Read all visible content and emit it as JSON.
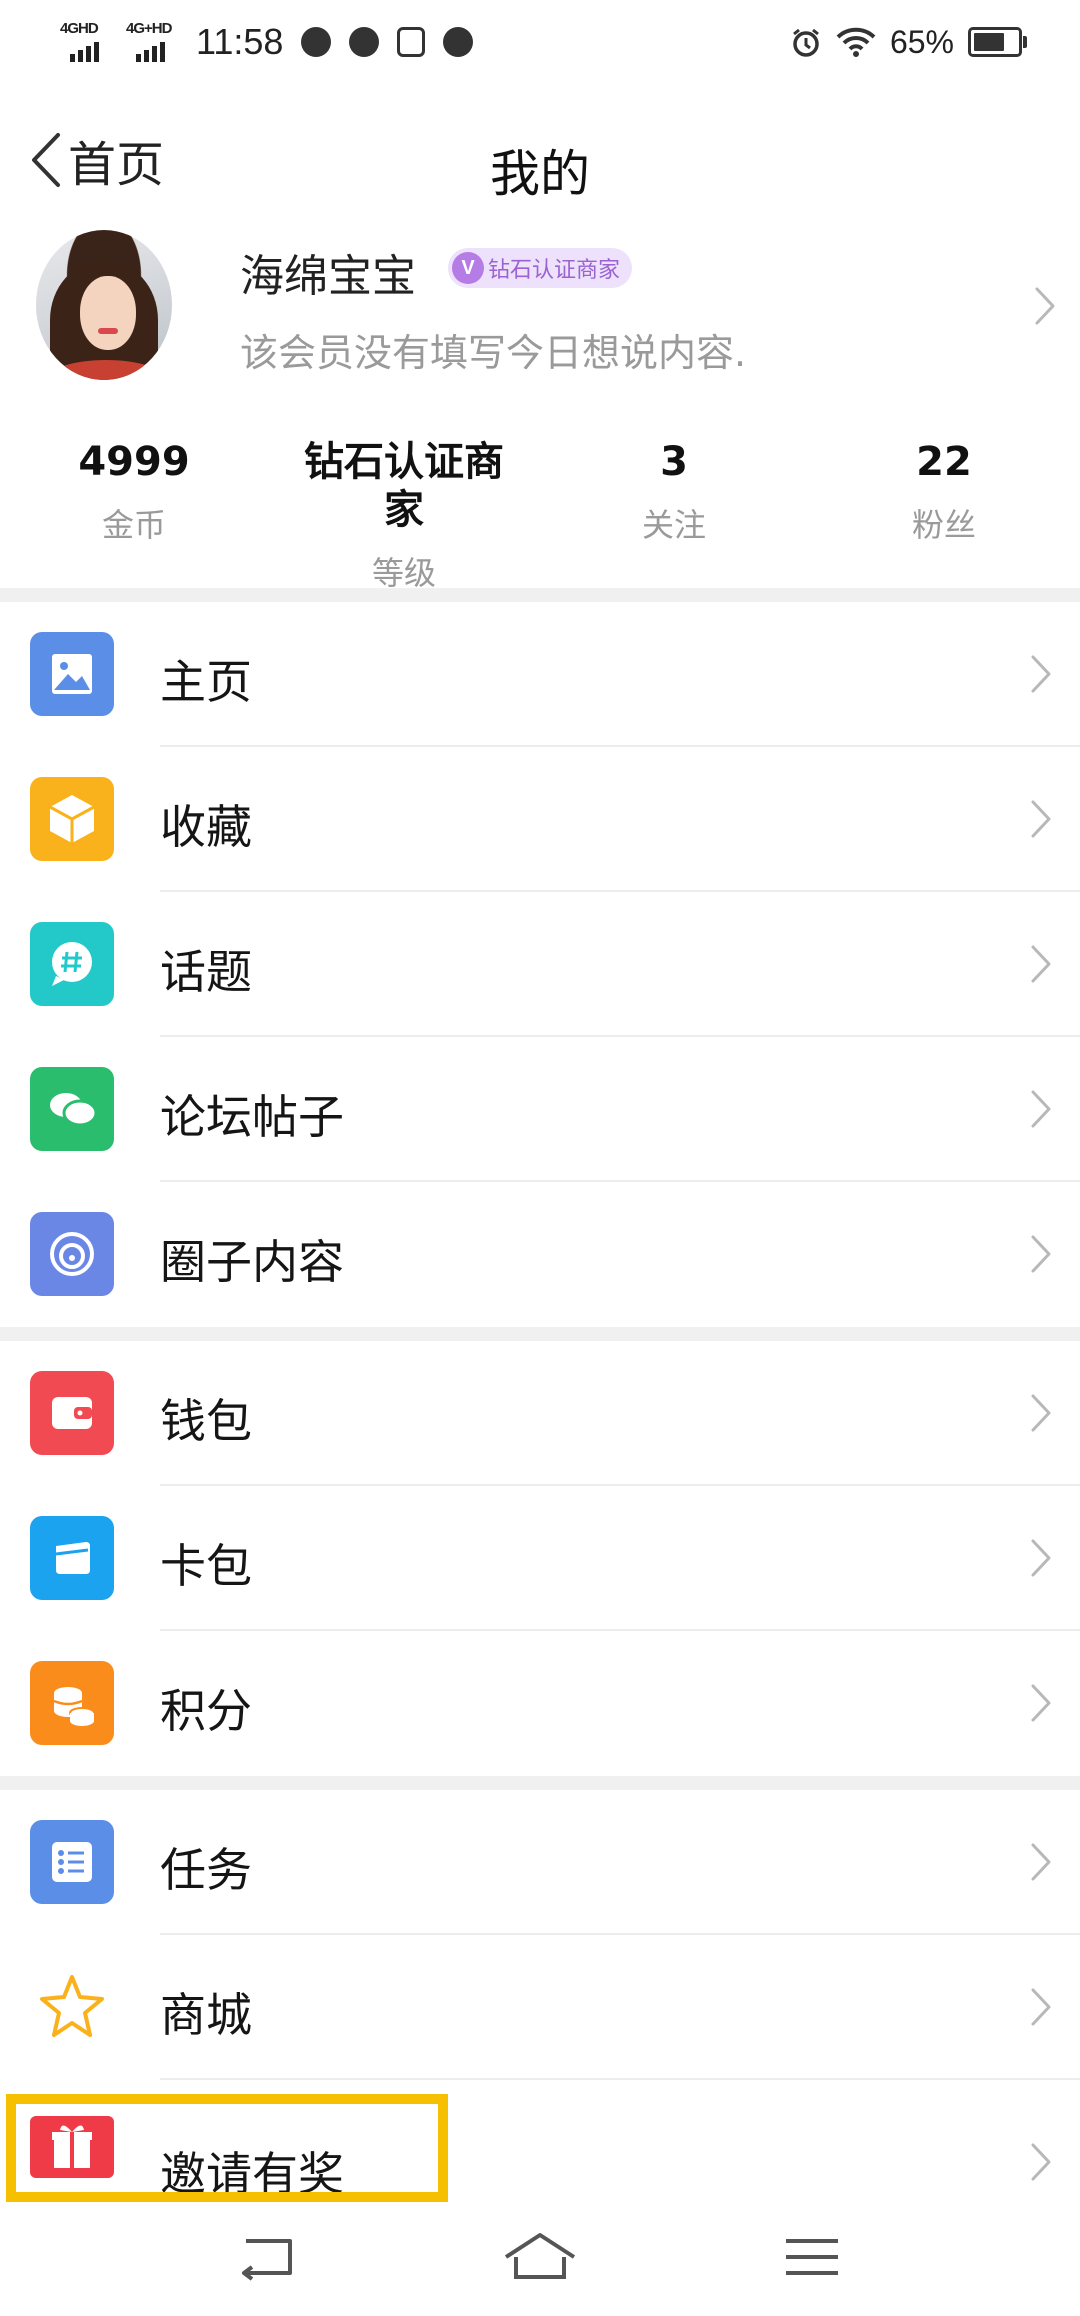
{
  "status_bar": {
    "net1": "4GHD",
    "net2": "4G+HD",
    "time": "11:58",
    "battery_pct": "65%",
    "battery_level": 0.65,
    "icons": [
      "wechat-icon",
      "compass-icon",
      "sim-icon",
      "message-icon",
      "alarm-icon",
      "wifi-icon",
      "battery-icon"
    ]
  },
  "nav": {
    "back_label": "首页",
    "title": "我的"
  },
  "profile": {
    "name": "海绵宝宝",
    "badge_v": "V",
    "badge_text": "钻石认证商家",
    "motto": "该会员没有填写今日想说内容."
  },
  "stats": [
    {
      "value": "4999",
      "label": "金币"
    },
    {
      "value": "钻石认证商家",
      "label": "等级"
    },
    {
      "value": "3",
      "label": "关注"
    },
    {
      "value": "22",
      "label": "粉丝"
    }
  ],
  "menu": [
    {
      "label": "主页",
      "icon": "image-icon",
      "color": "#5b8ee6"
    },
    {
      "label": "收藏",
      "icon": "box-icon",
      "color": "#f9b21b"
    },
    {
      "label": "话题",
      "icon": "hashtag-chat-icon",
      "color": "#23c9c9"
    },
    {
      "label": "论坛帖子",
      "icon": "chat-bubbles-icon",
      "color": "#2bbd6e"
    },
    {
      "label": "圈子内容",
      "icon": "swirl-icon",
      "color": "#6b87e6"
    },
    {
      "label": "钱包",
      "icon": "wallet-icon",
      "color": "#f24a52"
    },
    {
      "label": "卡包",
      "icon": "card-icon",
      "color": "#1ba3f0"
    },
    {
      "label": "积分",
      "icon": "coins-icon",
      "color": "#fa8c1c"
    },
    {
      "label": "任务",
      "icon": "checklist-icon",
      "color": "#5b8ee6"
    },
    {
      "label": "商城",
      "icon": "star-icon",
      "color": "#f9b21b"
    },
    {
      "label": "邀请有奖",
      "icon": "gift-icon",
      "color": "#ef3a48"
    }
  ],
  "colors": {
    "highlight": "#f6bf00",
    "section_gap": "#f0f0f0"
  },
  "bottom_nav": [
    "back-nav-icon",
    "home-nav-icon",
    "menu-nav-icon"
  ]
}
